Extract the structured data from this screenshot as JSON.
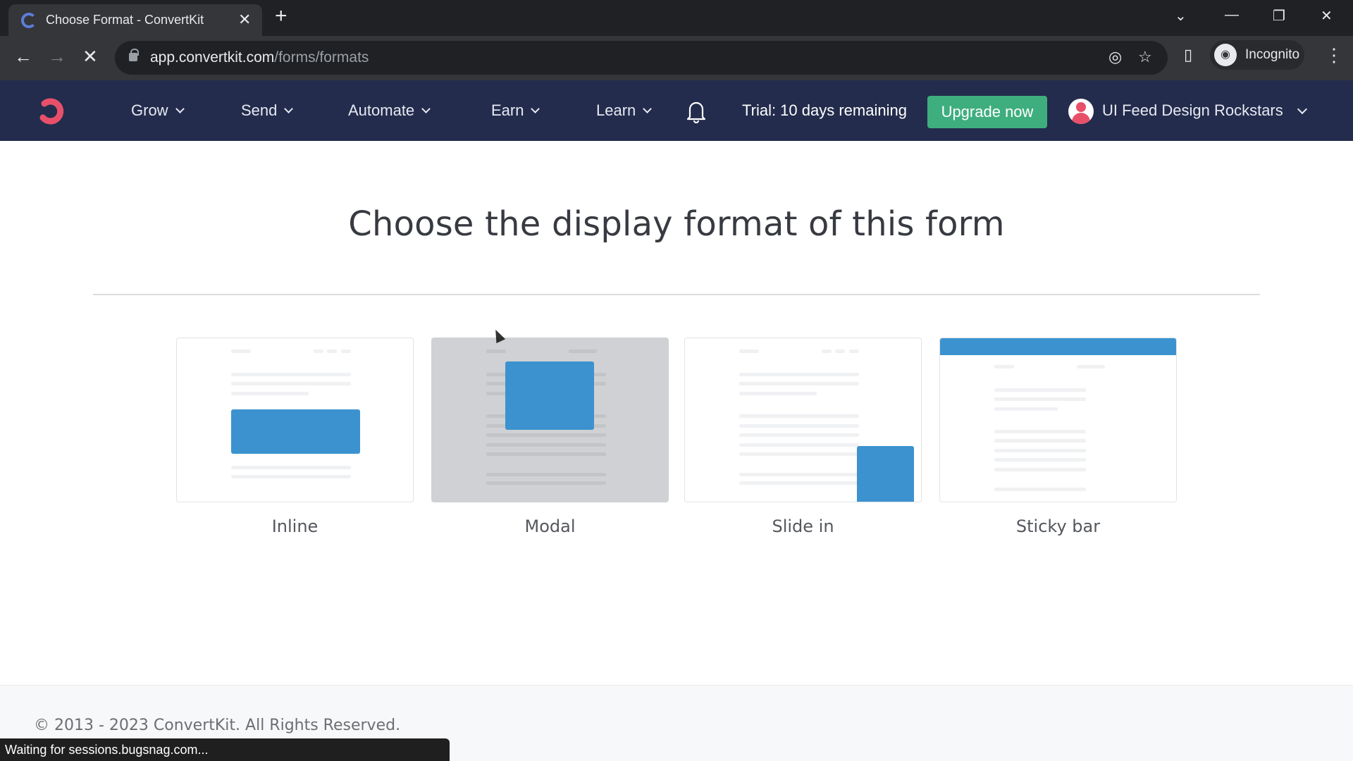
{
  "browser": {
    "tab_title": "Choose Format - ConvertKit",
    "new_tab_label": "+",
    "url_host": "app.convertkit.com",
    "url_path": "/forms/formats",
    "profile_label": "Incognito",
    "status_text": "Waiting for sessions.bugsnag.com...",
    "icons": {
      "back": "←",
      "forward": "→",
      "stop": "✕",
      "tab_close": "✕",
      "tab_search": "⌄",
      "minimize": "—",
      "restore": "❐",
      "close": "✕",
      "tracking_blocked": "◎",
      "bookmark": "☆",
      "side_panel": "▯",
      "incognito": "🕶",
      "menu": "⋮"
    }
  },
  "nav": {
    "items": [
      {
        "label": "Grow"
      },
      {
        "label": "Send"
      },
      {
        "label": "Automate"
      },
      {
        "label": "Earn"
      },
      {
        "label": "Learn"
      }
    ],
    "trial_text": "Trial: 10 days remaining",
    "upgrade_label": "Upgrade now",
    "account_name": "UI Feed Design Rockstars",
    "colors": {
      "nav_bg": "#232c4c",
      "logo": "#e8506a",
      "upgrade": "#3fae7e"
    }
  },
  "main": {
    "title": "Choose the display format of this form",
    "formats": [
      {
        "label": "Inline",
        "hovered": false
      },
      {
        "label": "Modal",
        "hovered": true
      },
      {
        "label": "Slide in",
        "hovered": false
      },
      {
        "label": "Sticky bar",
        "hovered": false
      }
    ],
    "accent": "#3c92cf"
  },
  "footer": {
    "copyright": "© 2013 - 2023 ConvertKit. All Rights Reserved."
  }
}
